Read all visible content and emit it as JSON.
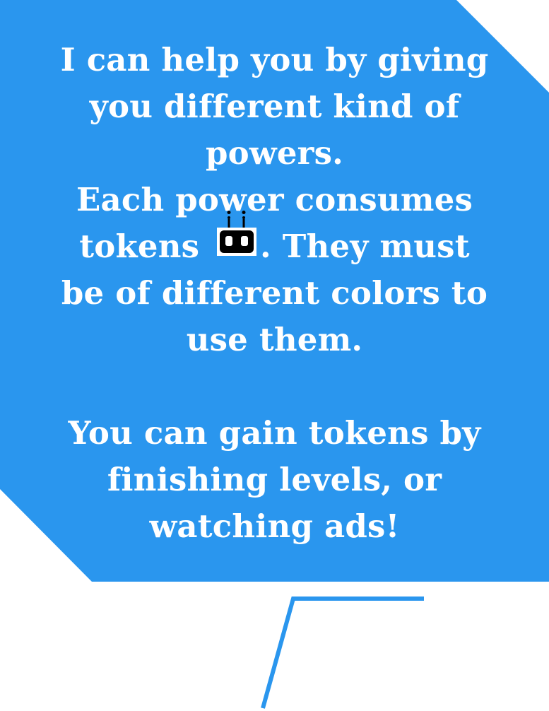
{
  "colors": {
    "bubble_fill": "#2a96ee",
    "text": "#ffffff",
    "tail": "#2a96ee",
    "background": "#ffffff"
  },
  "dialog": {
    "paragraph1_lines": [
      "I can help you by giving",
      "you different kind of",
      "powers.",
      "Each power consumes"
    ],
    "token_line_before": "tokens",
    "token_icon": "robot-token-icon",
    "token_line_after": ". They must",
    "paragraph1_tail_lines": [
      "be of different colors to",
      "use them."
    ],
    "paragraph2_lines": [
      "You can gain tokens by",
      "finishing levels, or",
      "watching ads!"
    ]
  }
}
